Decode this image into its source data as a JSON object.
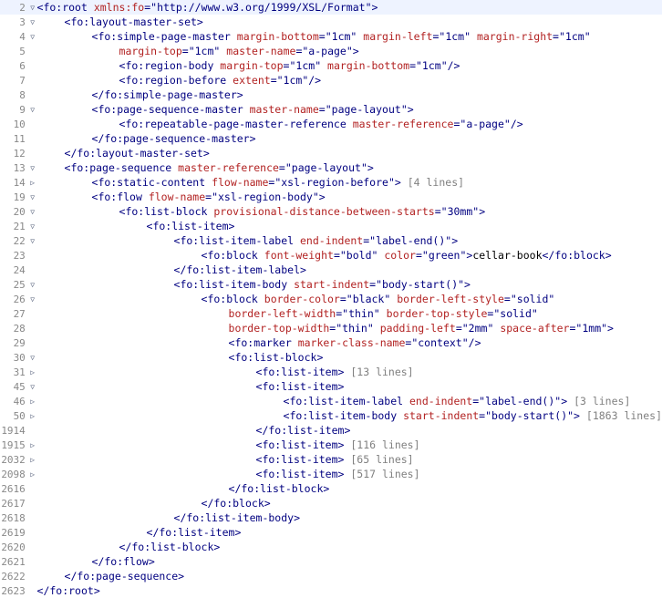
{
  "fold": {
    "open": "▽",
    "closed": "▷"
  },
  "lines": [
    {
      "n": 2,
      "f": "open",
      "hl": true,
      "indent": 0,
      "segs": [
        {
          "t": "tag",
          "v": "<fo:root "
        },
        {
          "t": "attr",
          "v": "xmlns:fo"
        },
        {
          "t": "tag",
          "v": "=\""
        },
        {
          "t": "val",
          "v": "http://www.w3.org/1999/XSL/Format"
        },
        {
          "t": "tag",
          "v": "\">"
        }
      ]
    },
    {
      "n": 3,
      "f": "open",
      "indent": 1,
      "segs": [
        {
          "t": "tag",
          "v": "<fo:layout-master-set>"
        }
      ]
    },
    {
      "n": 4,
      "f": "open",
      "indent": 2,
      "segs": [
        {
          "t": "tag",
          "v": "<fo:simple-page-master "
        },
        {
          "t": "attr",
          "v": "margin-bottom"
        },
        {
          "t": "tag",
          "v": "=\""
        },
        {
          "t": "val",
          "v": "1cm"
        },
        {
          "t": "tag",
          "v": "\" "
        },
        {
          "t": "attr",
          "v": "margin-left"
        },
        {
          "t": "tag",
          "v": "=\""
        },
        {
          "t": "val",
          "v": "1cm"
        },
        {
          "t": "tag",
          "v": "\" "
        },
        {
          "t": "attr",
          "v": "margin-right"
        },
        {
          "t": "tag",
          "v": "=\""
        },
        {
          "t": "val",
          "v": "1cm"
        },
        {
          "t": "tag",
          "v": "\""
        }
      ]
    },
    {
      "n": 5,
      "f": "",
      "indent": 3,
      "segs": [
        {
          "t": "attr",
          "v": "margin-top"
        },
        {
          "t": "tag",
          "v": "=\""
        },
        {
          "t": "val",
          "v": "1cm"
        },
        {
          "t": "tag",
          "v": "\" "
        },
        {
          "t": "attr",
          "v": "master-name"
        },
        {
          "t": "tag",
          "v": "=\""
        },
        {
          "t": "val",
          "v": "a-page"
        },
        {
          "t": "tag",
          "v": "\">"
        }
      ]
    },
    {
      "n": 6,
      "f": "",
      "indent": 3,
      "segs": [
        {
          "t": "tag",
          "v": "<fo:region-body "
        },
        {
          "t": "attr",
          "v": "margin-top"
        },
        {
          "t": "tag",
          "v": "=\""
        },
        {
          "t": "val",
          "v": "1cm"
        },
        {
          "t": "tag",
          "v": "\" "
        },
        {
          "t": "attr",
          "v": "margin-bottom"
        },
        {
          "t": "tag",
          "v": "=\""
        },
        {
          "t": "val",
          "v": "1cm"
        },
        {
          "t": "tag",
          "v": "\"/>"
        }
      ]
    },
    {
      "n": 7,
      "f": "",
      "indent": 3,
      "segs": [
        {
          "t": "tag",
          "v": "<fo:region-before "
        },
        {
          "t": "attr",
          "v": "extent"
        },
        {
          "t": "tag",
          "v": "=\""
        },
        {
          "t": "val",
          "v": "1cm"
        },
        {
          "t": "tag",
          "v": "\"/>"
        }
      ]
    },
    {
      "n": 8,
      "f": "",
      "indent": 2,
      "segs": [
        {
          "t": "tag",
          "v": "</fo:simple-page-master>"
        }
      ]
    },
    {
      "n": 9,
      "f": "open",
      "indent": 2,
      "segs": [
        {
          "t": "tag",
          "v": "<fo:page-sequence-master "
        },
        {
          "t": "attr",
          "v": "master-name"
        },
        {
          "t": "tag",
          "v": "=\""
        },
        {
          "t": "val",
          "v": "page-layout"
        },
        {
          "t": "tag",
          "v": "\">"
        }
      ]
    },
    {
      "n": 10,
      "f": "",
      "indent": 3,
      "segs": [
        {
          "t": "tag",
          "v": "<fo:repeatable-page-master-reference "
        },
        {
          "t": "attr",
          "v": "master-reference"
        },
        {
          "t": "tag",
          "v": "=\""
        },
        {
          "t": "val",
          "v": "a-page"
        },
        {
          "t": "tag",
          "v": "\"/>"
        }
      ]
    },
    {
      "n": 11,
      "f": "",
      "indent": 2,
      "segs": [
        {
          "t": "tag",
          "v": "</fo:page-sequence-master>"
        }
      ]
    },
    {
      "n": 12,
      "f": "",
      "indent": 1,
      "segs": [
        {
          "t": "tag",
          "v": "</fo:layout-master-set>"
        }
      ]
    },
    {
      "n": 13,
      "f": "open",
      "indent": 1,
      "segs": [
        {
          "t": "tag",
          "v": "<fo:page-sequence "
        },
        {
          "t": "attr",
          "v": "master-reference"
        },
        {
          "t": "tag",
          "v": "=\""
        },
        {
          "t": "val",
          "v": "page-layout"
        },
        {
          "t": "tag",
          "v": "\">"
        }
      ]
    },
    {
      "n": 14,
      "f": "closed",
      "indent": 2,
      "segs": [
        {
          "t": "tag",
          "v": "<fo:static-content "
        },
        {
          "t": "attr",
          "v": "flow-name"
        },
        {
          "t": "tag",
          "v": "=\""
        },
        {
          "t": "val",
          "v": "xsl-region-before"
        },
        {
          "t": "tag",
          "v": "\"> "
        },
        {
          "t": "fold-note",
          "v": "[4 lines]"
        }
      ]
    },
    {
      "n": 19,
      "f": "open",
      "indent": 2,
      "segs": [
        {
          "t": "tag",
          "v": "<fo:flow "
        },
        {
          "t": "attr",
          "v": "flow-name"
        },
        {
          "t": "tag",
          "v": "=\""
        },
        {
          "t": "val",
          "v": "xsl-region-body"
        },
        {
          "t": "tag",
          "v": "\">"
        }
      ]
    },
    {
      "n": 20,
      "f": "open",
      "indent": 3,
      "segs": [
        {
          "t": "tag",
          "v": "<fo:list-block "
        },
        {
          "t": "attr",
          "v": "provisional-distance-between-starts"
        },
        {
          "t": "tag",
          "v": "=\""
        },
        {
          "t": "val",
          "v": "30mm"
        },
        {
          "t": "tag",
          "v": "\">"
        }
      ]
    },
    {
      "n": 21,
      "f": "open",
      "indent": 4,
      "segs": [
        {
          "t": "tag",
          "v": "<fo:list-item>"
        }
      ]
    },
    {
      "n": 22,
      "f": "open",
      "indent": 5,
      "segs": [
        {
          "t": "tag",
          "v": "<fo:list-item-label "
        },
        {
          "t": "attr",
          "v": "end-indent"
        },
        {
          "t": "tag",
          "v": "=\""
        },
        {
          "t": "val",
          "v": "label-end()"
        },
        {
          "t": "tag",
          "v": "\">"
        }
      ]
    },
    {
      "n": 23,
      "f": "",
      "indent": 6,
      "segs": [
        {
          "t": "tag",
          "v": "<fo:block "
        },
        {
          "t": "attr",
          "v": "font-weight"
        },
        {
          "t": "tag",
          "v": "=\""
        },
        {
          "t": "val",
          "v": "bold"
        },
        {
          "t": "tag",
          "v": "\" "
        },
        {
          "t": "attr",
          "v": "color"
        },
        {
          "t": "tag",
          "v": "=\""
        },
        {
          "t": "val",
          "v": "green"
        },
        {
          "t": "tag",
          "v": "\">"
        },
        {
          "t": "xml-text",
          "v": "cellar-book"
        },
        {
          "t": "tag",
          "v": "</fo:block>"
        }
      ]
    },
    {
      "n": 24,
      "f": "",
      "indent": 5,
      "segs": [
        {
          "t": "tag",
          "v": "</fo:list-item-label>"
        }
      ]
    },
    {
      "n": 25,
      "f": "open",
      "indent": 5,
      "segs": [
        {
          "t": "tag",
          "v": "<fo:list-item-body "
        },
        {
          "t": "attr",
          "v": "start-indent"
        },
        {
          "t": "tag",
          "v": "=\""
        },
        {
          "t": "val",
          "v": "body-start()"
        },
        {
          "t": "tag",
          "v": "\">"
        }
      ]
    },
    {
      "n": 26,
      "f": "open",
      "indent": 6,
      "segs": [
        {
          "t": "tag",
          "v": "<fo:block "
        },
        {
          "t": "attr",
          "v": "border-color"
        },
        {
          "t": "tag",
          "v": "=\""
        },
        {
          "t": "val",
          "v": "black"
        },
        {
          "t": "tag",
          "v": "\" "
        },
        {
          "t": "attr",
          "v": "border-left-style"
        },
        {
          "t": "tag",
          "v": "=\""
        },
        {
          "t": "val",
          "v": "solid"
        },
        {
          "t": "tag",
          "v": "\""
        }
      ]
    },
    {
      "n": 27,
      "f": "",
      "indent": 7,
      "segs": [
        {
          "t": "attr",
          "v": "border-left-width"
        },
        {
          "t": "tag",
          "v": "=\""
        },
        {
          "t": "val",
          "v": "thin"
        },
        {
          "t": "tag",
          "v": "\" "
        },
        {
          "t": "attr",
          "v": "border-top-style"
        },
        {
          "t": "tag",
          "v": "=\""
        },
        {
          "t": "val",
          "v": "solid"
        },
        {
          "t": "tag",
          "v": "\""
        }
      ]
    },
    {
      "n": 28,
      "f": "",
      "indent": 7,
      "segs": [
        {
          "t": "attr",
          "v": "border-top-width"
        },
        {
          "t": "tag",
          "v": "=\""
        },
        {
          "t": "val",
          "v": "thin"
        },
        {
          "t": "tag",
          "v": "\" "
        },
        {
          "t": "attr",
          "v": "padding-left"
        },
        {
          "t": "tag",
          "v": "=\""
        },
        {
          "t": "val",
          "v": "2mm"
        },
        {
          "t": "tag",
          "v": "\" "
        },
        {
          "t": "attr",
          "v": "space-after"
        },
        {
          "t": "tag",
          "v": "=\""
        },
        {
          "t": "val",
          "v": "1mm"
        },
        {
          "t": "tag",
          "v": "\">"
        }
      ]
    },
    {
      "n": 29,
      "f": "",
      "indent": 7,
      "segs": [
        {
          "t": "tag",
          "v": "<fo:marker "
        },
        {
          "t": "attr",
          "v": "marker-class-name"
        },
        {
          "t": "tag",
          "v": "=\""
        },
        {
          "t": "val",
          "v": "context"
        },
        {
          "t": "tag",
          "v": "\"/>"
        }
      ]
    },
    {
      "n": 30,
      "f": "open",
      "indent": 7,
      "segs": [
        {
          "t": "tag",
          "v": "<fo:list-block>"
        }
      ]
    },
    {
      "n": 31,
      "f": "closed",
      "indent": 8,
      "segs": [
        {
          "t": "tag",
          "v": "<fo:list-item> "
        },
        {
          "t": "fold-note",
          "v": "[13 lines]"
        }
      ]
    },
    {
      "n": 45,
      "f": "open",
      "indent": 8,
      "segs": [
        {
          "t": "tag",
          "v": "<fo:list-item>"
        }
      ]
    },
    {
      "n": 46,
      "f": "closed",
      "indent": 9,
      "segs": [
        {
          "t": "tag",
          "v": "<fo:list-item-label "
        },
        {
          "t": "attr",
          "v": "end-indent"
        },
        {
          "t": "tag",
          "v": "=\""
        },
        {
          "t": "val",
          "v": "label-end()"
        },
        {
          "t": "tag",
          "v": "\"> "
        },
        {
          "t": "fold-note",
          "v": "[3 lines]"
        }
      ]
    },
    {
      "n": 50,
      "f": "closed",
      "indent": 9,
      "segs": [
        {
          "t": "tag",
          "v": "<fo:list-item-body "
        },
        {
          "t": "attr",
          "v": "start-indent"
        },
        {
          "t": "tag",
          "v": "=\""
        },
        {
          "t": "val",
          "v": "body-start()"
        },
        {
          "t": "tag",
          "v": "\"> "
        },
        {
          "t": "fold-note",
          "v": "[1863 lines]"
        }
      ]
    },
    {
      "n": 1914,
      "f": "",
      "indent": 8,
      "segs": [
        {
          "t": "tag",
          "v": "</fo:list-item>"
        }
      ]
    },
    {
      "n": 1915,
      "f": "closed",
      "indent": 8,
      "segs": [
        {
          "t": "tag",
          "v": "<fo:list-item> "
        },
        {
          "t": "fold-note",
          "v": "[116 lines]"
        }
      ]
    },
    {
      "n": 2032,
      "f": "closed",
      "indent": 8,
      "segs": [
        {
          "t": "tag",
          "v": "<fo:list-item> "
        },
        {
          "t": "fold-note",
          "v": "[65 lines]"
        }
      ]
    },
    {
      "n": 2098,
      "f": "closed",
      "indent": 8,
      "segs": [
        {
          "t": "tag",
          "v": "<fo:list-item> "
        },
        {
          "t": "fold-note",
          "v": "[517 lines]"
        }
      ]
    },
    {
      "n": 2616,
      "f": "",
      "indent": 7,
      "segs": [
        {
          "t": "tag",
          "v": "</fo:list-block>"
        }
      ]
    },
    {
      "n": 2617,
      "f": "",
      "indent": 6,
      "segs": [
        {
          "t": "tag",
          "v": "</fo:block>"
        }
      ]
    },
    {
      "n": 2618,
      "f": "",
      "indent": 5,
      "segs": [
        {
          "t": "tag",
          "v": "</fo:list-item-body>"
        }
      ]
    },
    {
      "n": 2619,
      "f": "",
      "indent": 4,
      "segs": [
        {
          "t": "tag",
          "v": "</fo:list-item>"
        }
      ]
    },
    {
      "n": 2620,
      "f": "",
      "indent": 3,
      "segs": [
        {
          "t": "tag",
          "v": "</fo:list-block>"
        }
      ]
    },
    {
      "n": 2621,
      "f": "",
      "indent": 2,
      "segs": [
        {
          "t": "tag",
          "v": "</fo:flow>"
        }
      ]
    },
    {
      "n": 2622,
      "f": "",
      "indent": 1,
      "segs": [
        {
          "t": "tag",
          "v": "</fo:page-sequence>"
        }
      ]
    },
    {
      "n": 2623,
      "f": "",
      "indent": 0,
      "segs": [
        {
          "t": "tag",
          "v": "</fo:root>"
        }
      ]
    }
  ]
}
